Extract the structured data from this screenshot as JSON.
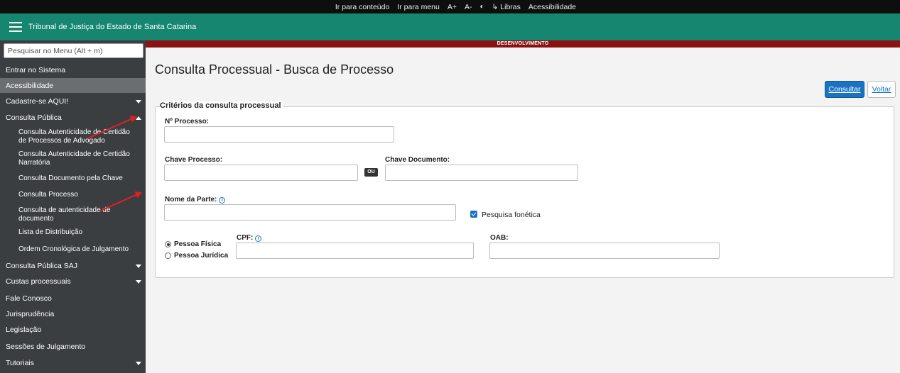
{
  "topbar": {
    "links": [
      "Ir para conteúdo",
      "Ir para menu",
      "A+",
      "A-",
      "◐",
      "Libras",
      "Acessibilidade"
    ]
  },
  "header": {
    "title": "Tribunal de Justiça do Estado de Santa Catarina",
    "bg_color": "#168670"
  },
  "sidebar": {
    "search_placeholder": "Pesquisar no Menu (Alt + m)",
    "items": [
      {
        "label": "Entrar no Sistema"
      },
      {
        "label": "Acessibilidade"
      },
      {
        "label": "Cadastre-se AQUI!"
      },
      {
        "label": "Consulta Pública"
      },
      {
        "label": "Consulta Pública SAJ"
      },
      {
        "label": "Custas processuais"
      },
      {
        "label": "Fale Conosco"
      },
      {
        "label": "Jurisprudência"
      },
      {
        "label": "Legislação"
      },
      {
        "label": "Sessões de Julgamento"
      },
      {
        "label": "Tutoriais"
      }
    ],
    "subitems": [
      "Consulta Autenticidade de Certidão de Processos de Advogado",
      "Consulta Autenticidade de Certidão Narratória",
      "Consulta Documento pela Chave",
      "Consulta Processo",
      "Consulta de autenticidade de documento",
      "Lista de Distribuição",
      "Ordem Cronológica de Julgamento"
    ]
  },
  "devbar": {
    "text": "DESENVOLVIMENTO"
  },
  "main": {
    "title": "Consulta Processual - Busca de Processo",
    "btn_consultar": "Consultar",
    "btn_voltar": "Voltar",
    "legend": "Critérios da consulta processual",
    "fields": {
      "num_processo": "Nº Processo:",
      "chave_processo": "Chave Processo:",
      "ou": "OU",
      "chave_documento": "Chave Documento:",
      "nome_parte": "Nome da Parte:",
      "pesquisa_fonetica": "Pesquisa fonética",
      "pessoa_fisica": "Pessoa Física",
      "pessoa_juridica": "Pessoa Jurídica",
      "cpf": "CPF:",
      "oab": "OAB:"
    }
  }
}
